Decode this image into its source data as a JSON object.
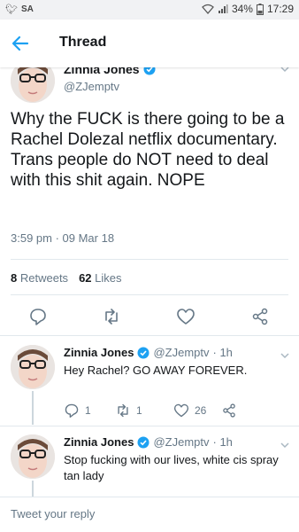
{
  "statusbar": {
    "carrier": "SA",
    "battery": "34%",
    "time": "17:29"
  },
  "header": {
    "title": "Thread"
  },
  "main_tweet": {
    "name": "Zinnia Jones",
    "handle": "@ZJemptv",
    "text": "Why the FUCK is there going to be a Rachel Dolezal netflix documentary. Trans people do NOT need to deal with this shit again. NOPE",
    "time": "3:59 pm · 09 Mar 18",
    "retweets_count": "8",
    "retweets_label": "Retweets",
    "likes_count": "62",
    "likes_label": "Likes"
  },
  "replies": [
    {
      "name": "Zinnia Jones",
      "handle": "@ZJemptv",
      "age": "· 1h",
      "text": "Hey Rachel? GO AWAY FOREVER.",
      "reply_count": "1",
      "retweet_count": "1",
      "like_count": "26"
    },
    {
      "name": "Zinnia Jones",
      "handle": "@ZJemptv",
      "age": "· 1h",
      "text": "Stop fucking with our lives, white cis spray tan lady"
    }
  ],
  "compose": {
    "placeholder": "Tweet your reply"
  },
  "colors": {
    "accent": "#1da1f2",
    "text": "#14171a",
    "muted": "#657786",
    "divider": "#e1e8ed"
  }
}
